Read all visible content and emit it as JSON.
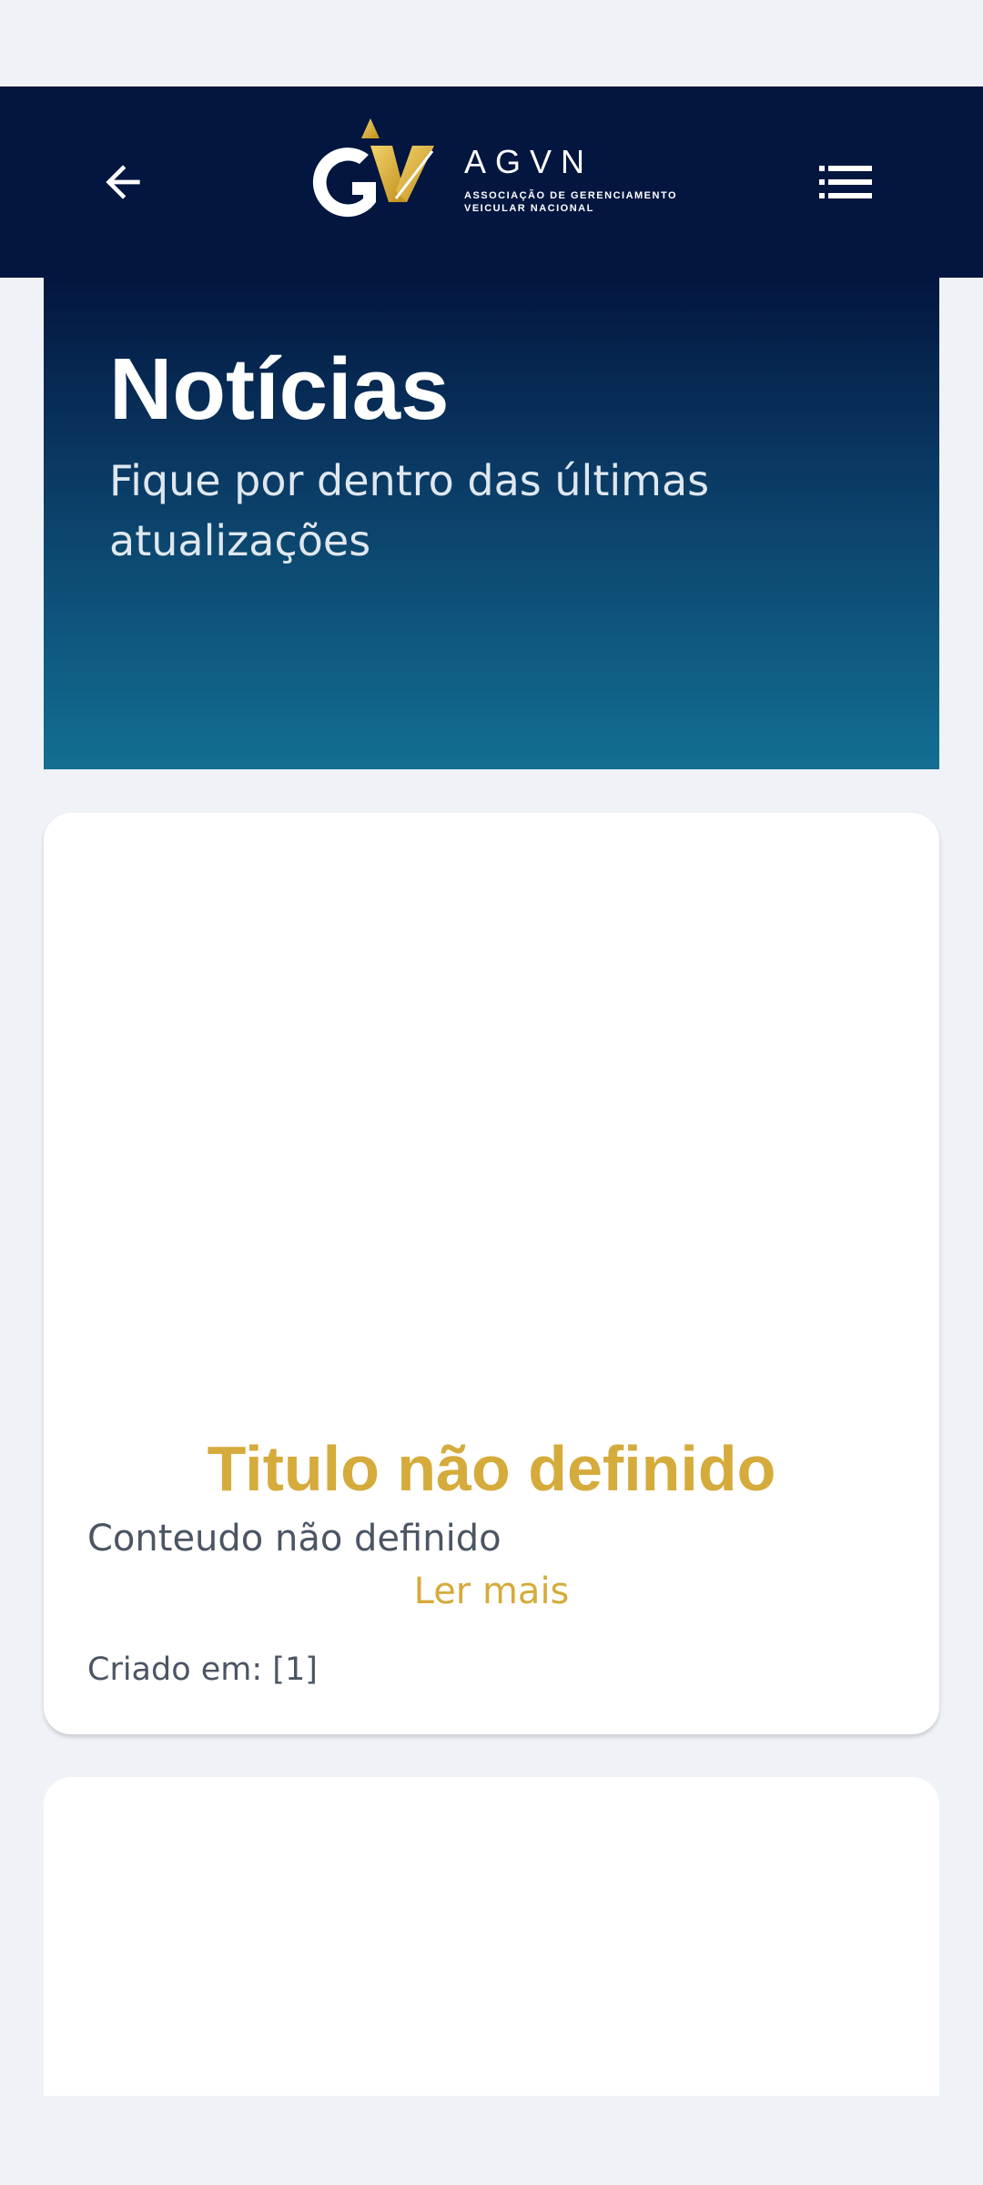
{
  "header": {
    "logo_name": "AGVN",
    "logo_tagline_1": "ASSOCIAÇÃO DE GERENCIAMENTO",
    "logo_tagline_2": "VEICULAR NACIONAL",
    "back_icon": "arrow-left-icon",
    "menu_icon": "list-menu-icon"
  },
  "hero": {
    "title": "Notícias",
    "subtitle": "Fique por dentro das últimas atualizações"
  },
  "news": [
    {
      "title": "Titulo não definido",
      "content": "Conteudo não definido",
      "read_more": "Ler mais",
      "created_at": "Criado em: [1]"
    }
  ],
  "colors": {
    "navy": "#02163f",
    "accent_gold": "#d5ab3c",
    "teal": "#136f93",
    "background": "#eff2f7"
  }
}
